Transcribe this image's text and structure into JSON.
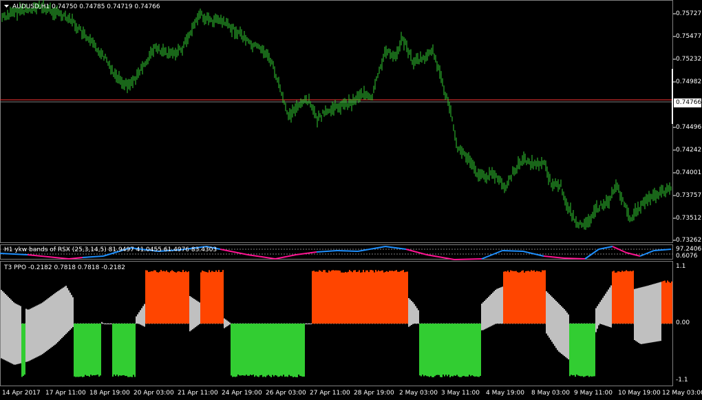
{
  "main": {
    "symbol_title": "AUDUSD,H1  0.74750 0.74785 0.74719 0.74766",
    "current_price": "0.74766",
    "price_labels": [
      "0.75727",
      "0.75477",
      "0.75232",
      "0.74982",
      "0.74766",
      "0.74496",
      "0.74242",
      "0.74001",
      "0.73757",
      "0.73512",
      "0.73262"
    ]
  },
  "rsx": {
    "title": "H1 ykw bands of RSX (25,3,14,5) 81.9497 41.0455 61.4976 83.4303",
    "labels": [
      "97.2406",
      "0.6076"
    ]
  },
  "ppo": {
    "title": "T3 PPO -0.2182 0.7818 0.7818 -0.2182",
    "labels": [
      "1.1",
      "0.00",
      "-1.1"
    ]
  },
  "dates": [
    "14 Apr 2017",
    "17 Apr 11:00",
    "18 Apr 19:00",
    "20 Apr 03:00",
    "21 Apr 11:00",
    "24 Apr 19:00",
    "26 Apr 03:00",
    "27 Apr 11:00",
    "28 Apr 19:00",
    "2 May 03:00",
    "3 May 11:00",
    "4 May 19:00",
    "8 May 03:00",
    "9 May 11:00",
    "10 May 19:00",
    "12 May 03:00"
  ],
  "colors": {
    "candle": "#32cd32",
    "hline_red": "#ff3333",
    "rsx_blue": "#1e90ff",
    "rsx_pink": "#ff1493",
    "ppo_gray": "#c0c0c0",
    "ppo_orange": "#ff4500",
    "ppo_green": "#32cd32"
  }
}
